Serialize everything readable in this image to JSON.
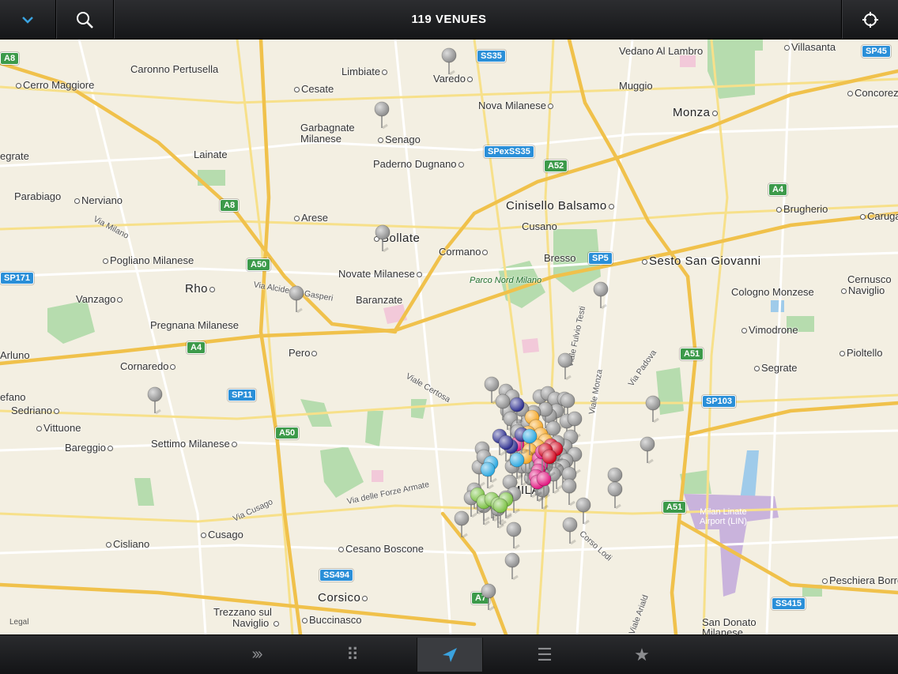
{
  "topbar": {
    "title": "119 VENUES",
    "collapse_icon": "chevron-down-icon",
    "search_icon": "search-icon",
    "locate_icon": "crosshair-icon"
  },
  "map": {
    "legal": "Legal",
    "places": [
      {
        "name": "Cerro Maggiore"
      },
      {
        "name": "Caronno Pertusella"
      },
      {
        "name": "Limbiate"
      },
      {
        "name": "Varedo"
      },
      {
        "name": "Vedano Al Lambro"
      },
      {
        "name": "Villasanta"
      },
      {
        "name": "Muggio"
      },
      {
        "name": "Nova Milanese"
      },
      {
        "name": "Monza"
      },
      {
        "name": "Concorezzo"
      },
      {
        "name": "Cesate"
      },
      {
        "name": "Garbagnate"
      },
      {
        "name": "Milanese"
      },
      {
        "name": "Senago"
      },
      {
        "name": "Lainate"
      },
      {
        "name": "egrate"
      },
      {
        "name": "Paderno Dugnano"
      },
      {
        "name": "Parabiago"
      },
      {
        "name": "Nerviano"
      },
      {
        "name": "Cinisello Balsamo"
      },
      {
        "name": "Brugherio"
      },
      {
        "name": "Carugate"
      },
      {
        "name": "Arese"
      },
      {
        "name": "Cusano"
      },
      {
        "name": "Bollate"
      },
      {
        "name": "Cormano"
      },
      {
        "name": "Bresso"
      },
      {
        "name": "Sesto San Giovanni"
      },
      {
        "name": "Pogliano Milanese"
      },
      {
        "name": "Novate Milanese"
      },
      {
        "name": "Cernusco"
      },
      {
        "name": "Naviglio"
      },
      {
        "name": "Rho"
      },
      {
        "name": "Vanzago"
      },
      {
        "name": "Baranzate"
      },
      {
        "name": "Cologno Monzese"
      },
      {
        "name": "Pregnana Milanese"
      },
      {
        "name": "Vimodrone"
      },
      {
        "name": "Arluno"
      },
      {
        "name": "Pero"
      },
      {
        "name": "Cornaredo"
      },
      {
        "name": "Segrate"
      },
      {
        "name": "Pioltello"
      },
      {
        "name": "efano"
      },
      {
        "name": "Sedriano"
      },
      {
        "name": "Vittuone"
      },
      {
        "name": "Bareggio"
      },
      {
        "name": "Settimo Milanese"
      },
      {
        "name": "MILAN"
      },
      {
        "name": "Cisliano"
      },
      {
        "name": "Cusago"
      },
      {
        "name": "Cesano Boscone"
      },
      {
        "name": "Corsico"
      },
      {
        "name": "Buccinasco"
      },
      {
        "name": "Trezzano sul"
      },
      {
        "name": "Naviglio "
      },
      {
        "name": "Peschiera Borromeo"
      },
      {
        "name": "San Donato"
      },
      {
        "name": "Milanese "
      },
      {
        "name": "Parco Nord Milano"
      },
      {
        "name": "Milan Linate"
      },
      {
        "name": "Airport (LIN)"
      }
    ],
    "roads": [
      "Via Milano",
      "Via Alcide De Gasperi",
      "Viale Fulvio Testi",
      "Viale Certosa",
      "Viale Monza",
      "Via Padova",
      "Via delle Forze Armate",
      "Via Cusago",
      "Corso Lodi",
      "Viale Ariald"
    ],
    "shields": [
      "A8",
      "SS35",
      "SP45",
      "SPexSS35",
      "A52",
      "A8 ",
      "A4",
      "SP5",
      "A50",
      "SP171",
      "A4 ",
      "A51",
      "SP11",
      "SP103",
      "A50 ",
      "A51 ",
      "SS494",
      "A7",
      "SS415"
    ],
    "pins": [
      {
        "color": "#8e8e8e",
        "count": 78
      },
      {
        "color": "#f5a623",
        "count": 10
      },
      {
        "color": "#e0157e",
        "count": 8
      },
      {
        "color": "#2d2f8f",
        "count": 5
      },
      {
        "color": "#d0021b",
        "count": 4
      },
      {
        "color": "#2ba8e0",
        "count": 4
      },
      {
        "color": "#7ac142",
        "count": 6
      }
    ]
  },
  "bottombar": {
    "tabs": [
      {
        "name": "more",
        "glyph": "›››"
      },
      {
        "name": "grid",
        "glyph": "⠿"
      },
      {
        "name": "map",
        "glyph": "➤"
      },
      {
        "name": "list",
        "glyph": "☰"
      },
      {
        "name": "favorites",
        "glyph": "★"
      }
    ]
  },
  "colors": {
    "accent": "#3aa3e0",
    "map_bg": "#f3efe2",
    "motorway": "#f0c14b",
    "park": "#b6dcae"
  }
}
